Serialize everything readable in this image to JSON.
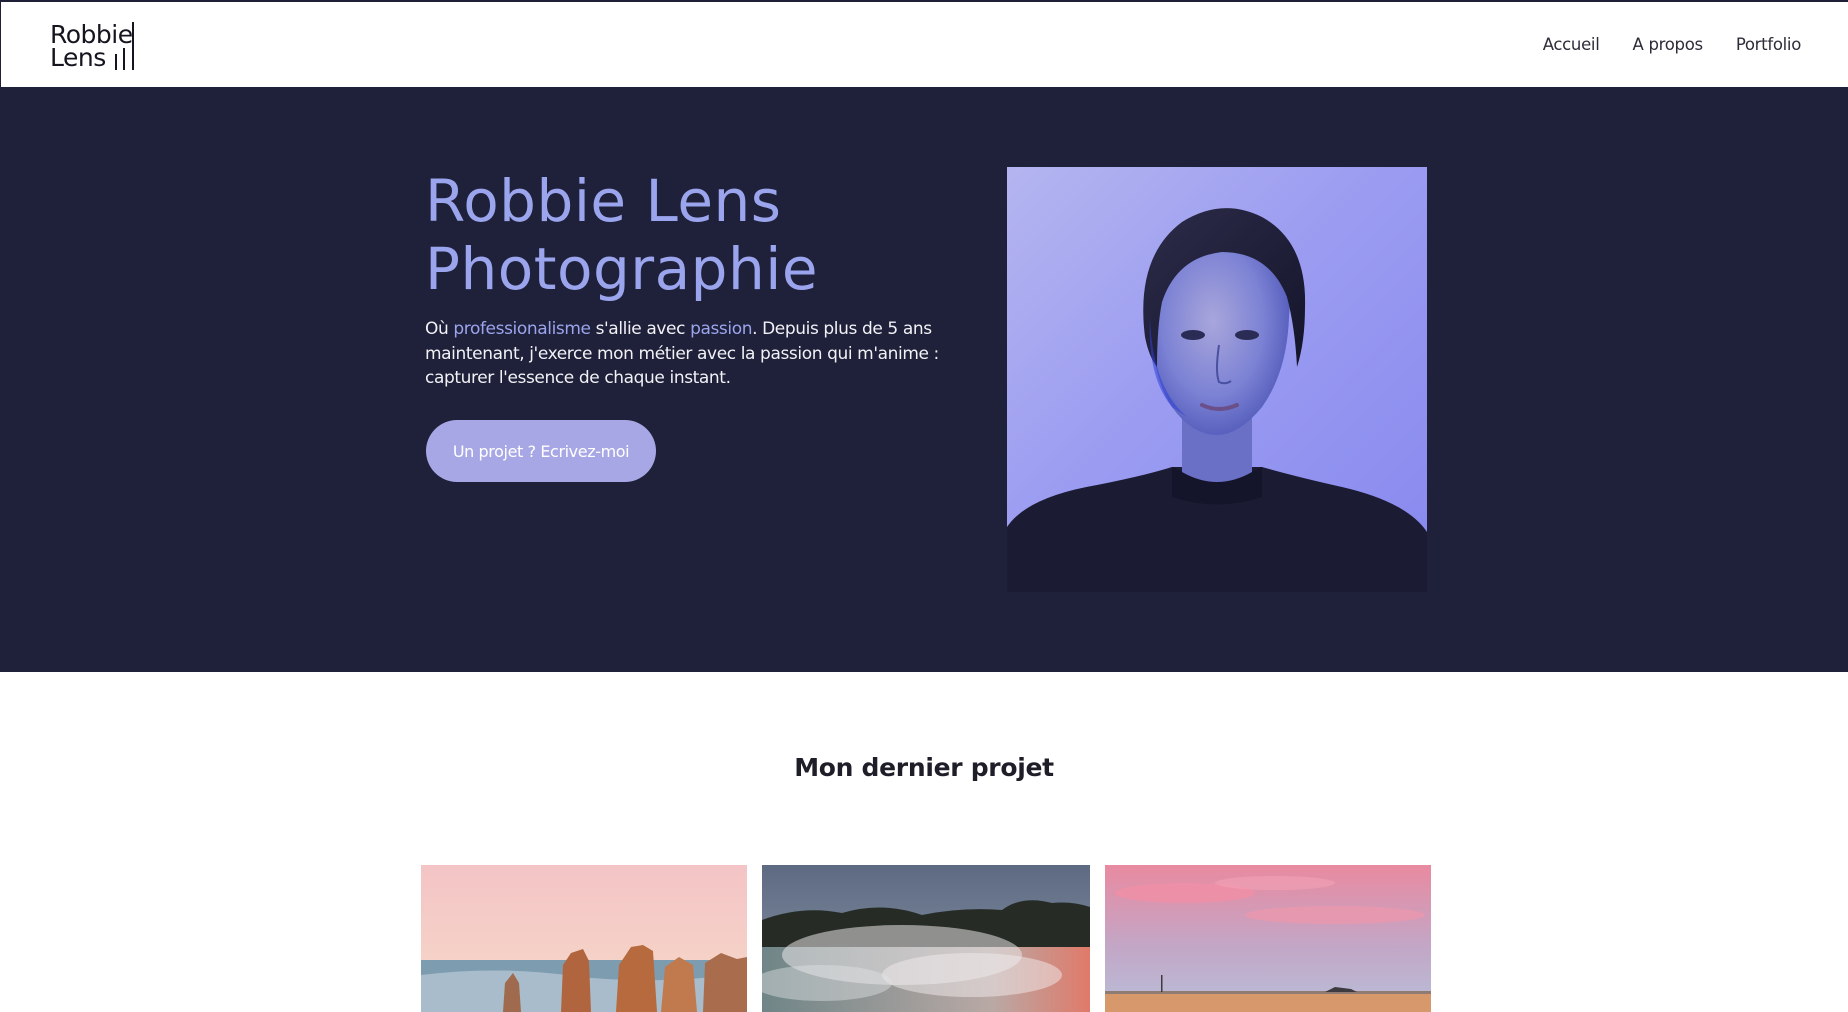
{
  "header": {
    "logo_line1": "Robbie",
    "logo_line2": "Lens",
    "nav": [
      {
        "label": "Accueil"
      },
      {
        "label": "A propos"
      },
      {
        "label": "Portfolio"
      }
    ]
  },
  "hero": {
    "title_line1": "Robbie Lens",
    "title_line2": "Photographie",
    "text_part1": "Où ",
    "text_accent1": "professionalisme",
    "text_part2": " s'allie avec ",
    "text_accent2": "passion",
    "text_part3": ". Depuis plus de 5 ans maintenant, j'exerce mon métier avec la passion qui m'anime : capturer l'essence de chaque instant.",
    "cta_label": "Un projet ? Ecrivez-moi"
  },
  "project": {
    "title": "Mon dernier projet"
  },
  "colors": {
    "hero_bg": "#1f2039",
    "accent": "#9ba5ee",
    "button": "#a8a7e6"
  }
}
